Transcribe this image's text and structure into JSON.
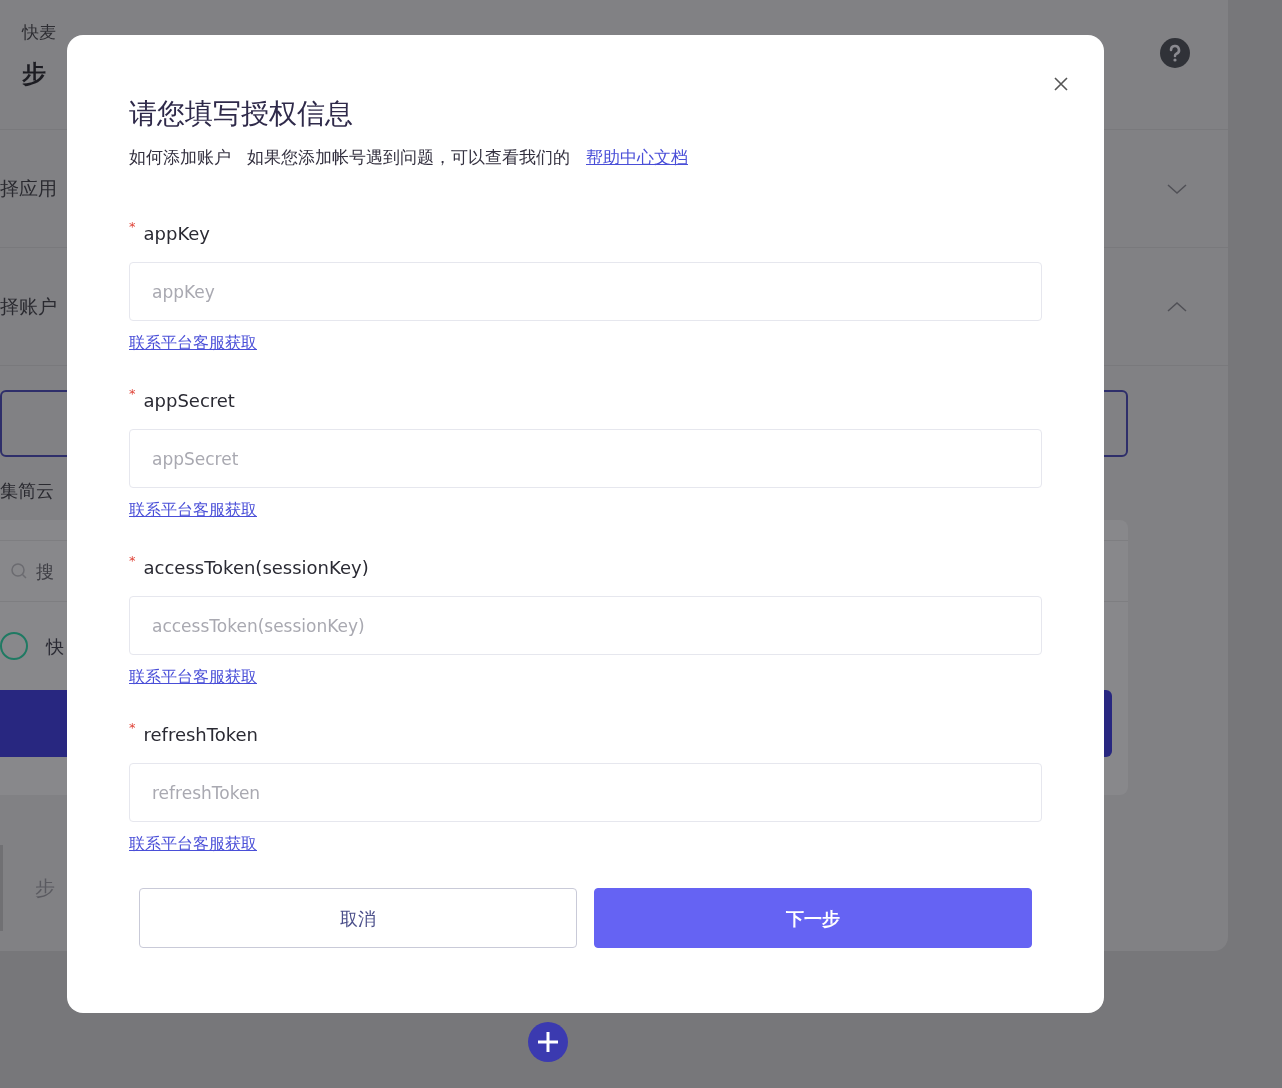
{
  "background": {
    "breadcrumb": "快麦",
    "heading": "步",
    "sections": [
      {
        "label": "择应用",
        "expanded": false
      },
      {
        "label": "择账户",
        "expanded": true
      }
    ],
    "app_label": "集简云",
    "search_placeholder": "搜",
    "account": {
      "label": "快",
      "selected": false
    },
    "next_step": "步"
  },
  "dialog": {
    "title": "请您填写授权信息",
    "help_label": "如何添加账户",
    "help_text": "如果您添加帐号遇到问题，可以查看我们的",
    "help_link": "帮助中心文档",
    "fields": [
      {
        "label": "appKey",
        "required_mark": "*",
        "placeholder": "appKey",
        "hint_link": "联系平台客服获取"
      },
      {
        "label": "appSecret",
        "required_mark": "*",
        "placeholder": "appSecret",
        "hint_link": "联系平台客服获取"
      },
      {
        "label": "accessToken(sessionKey)",
        "required_mark": "*",
        "placeholder": "accessToken(sessionKey)",
        "hint_link": "联系平台客服获取"
      },
      {
        "label": "refreshToken",
        "required_mark": "*",
        "placeholder": "refreshToken",
        "hint_link": "联系平台客服获取"
      }
    ],
    "buttons": [
      {
        "label": "取消",
        "kind": "secondary"
      },
      {
        "label": "下一步",
        "kind": "primary"
      }
    ]
  }
}
